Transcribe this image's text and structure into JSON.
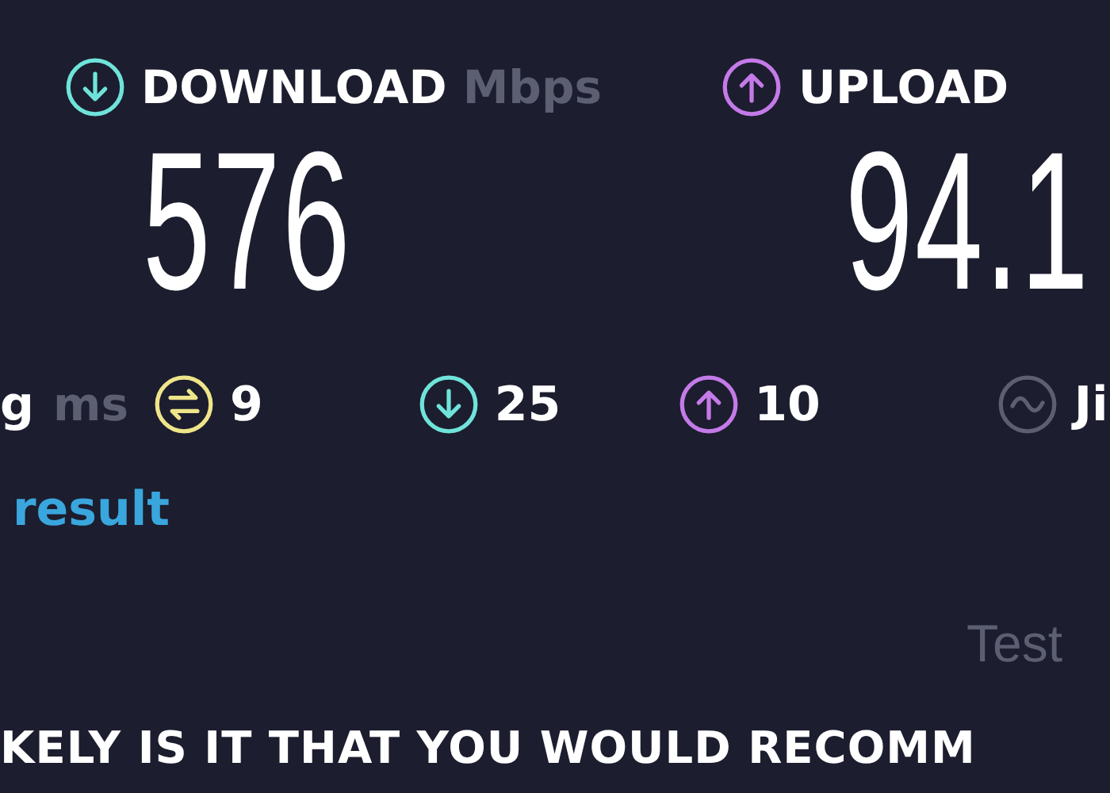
{
  "download": {
    "label": "DOWNLOAD",
    "unit": "Mbps",
    "value": "576"
  },
  "upload": {
    "label": "UPLOAD",
    "value": "94.1"
  },
  "ping": {
    "label": "g",
    "unit": "ms"
  },
  "latency": [
    {
      "kind": "idle",
      "value": "9"
    },
    {
      "kind": "download",
      "value": "25"
    },
    {
      "kind": "upload",
      "value": "10"
    }
  ],
  "jitter": {
    "label": "Ji"
  },
  "result_link": "result",
  "test_label": "Test",
  "question": "KELY IS IT THAT YOU WOULD RECOMM"
}
